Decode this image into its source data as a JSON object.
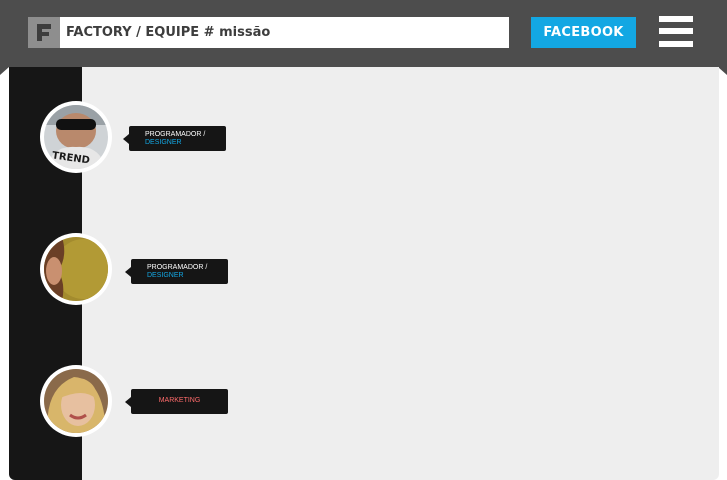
{
  "header": {
    "breadcrumb": "FACTORY / EQUIPE # missão",
    "facebook_label": "FACEBOOK",
    "logo_icon": "factory-f-logo-icon",
    "menu_icon": "hamburger-menu-icon"
  },
  "colors": {
    "topbar": "#4d4d4d",
    "accent": "#13a7e3",
    "panel": "#eeeeee",
    "rail": "#161616",
    "marketing": "#ff6b6b"
  },
  "team": [
    {
      "role_line1": "PROGRAMADOR /",
      "role_line2": "DESIGNER"
    },
    {
      "role_line1": "PROGRAMADOR /",
      "role_line2": "DESIGNER"
    },
    {
      "role_line1": "MARKETING"
    }
  ]
}
